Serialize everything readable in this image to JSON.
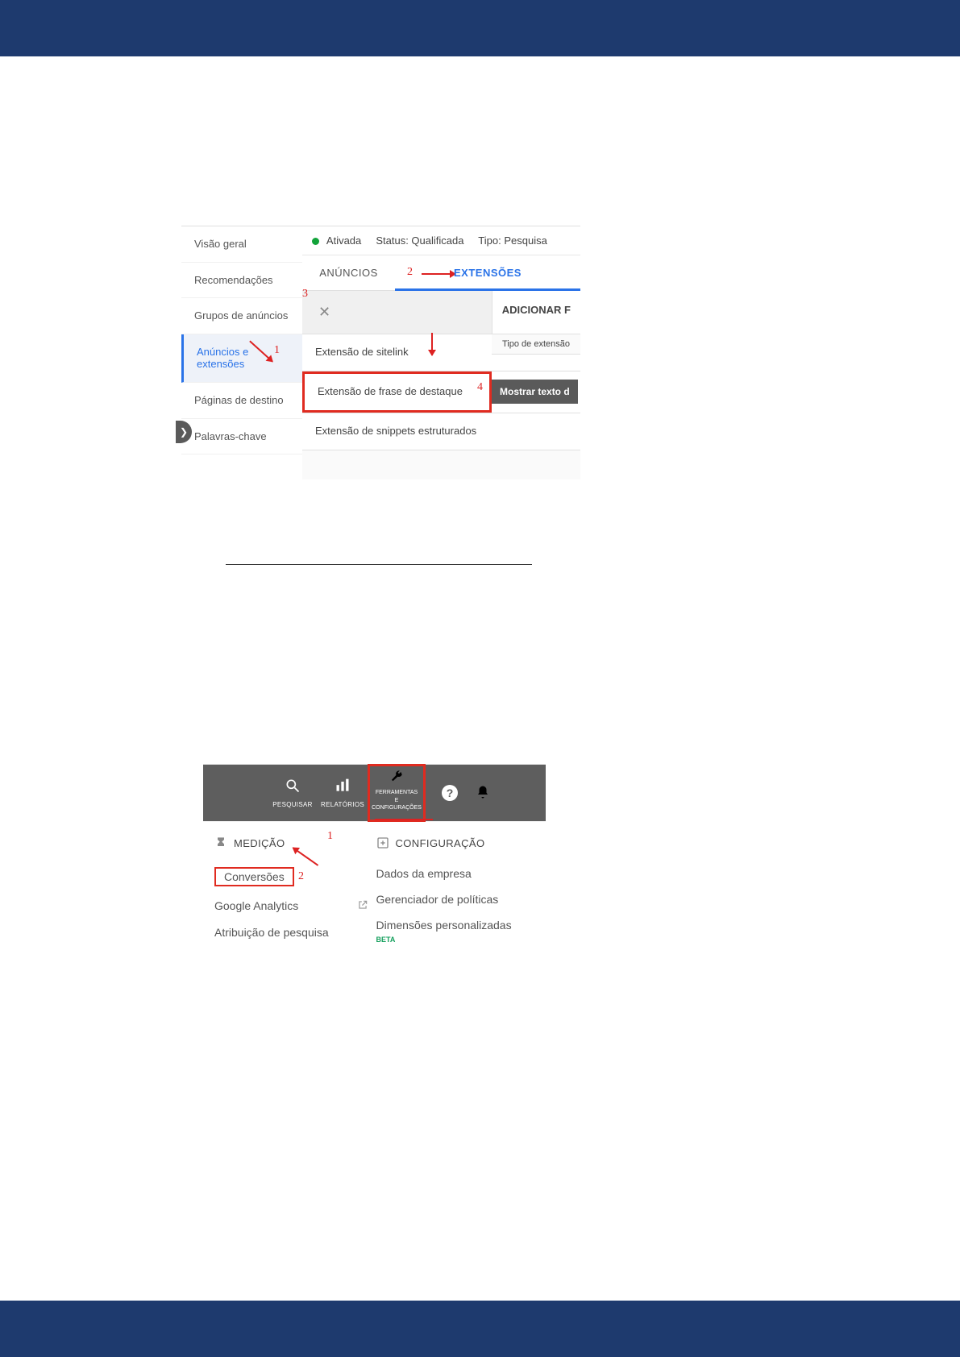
{
  "annotations": {
    "n1": "1",
    "n2": "2",
    "n3": "3",
    "n4": "4"
  },
  "shot1": {
    "sidebar": {
      "items": [
        "Visão geral",
        "Recomendações",
        "Grupos de anúncios",
        "Anúncios e extensões",
        "Páginas de destino",
        "Palavras-chave"
      ]
    },
    "status": {
      "state": "Ativada",
      "status_label": "Status: Qualificada",
      "type": "Tipo: Pesquisa"
    },
    "tabs": {
      "anuncios": "ANÚNCIOS",
      "extensoes": "EXTENSÕES"
    },
    "add_filter": "ADICIONAR F",
    "tipo_ext": "Tipo de extensão",
    "extensions": {
      "sitelink": "Extensão de sitelink",
      "frase": "Extensão de frase de destaque",
      "snippets": "Extensão de snippets estruturados",
      "mostrar": "Mostrar texto d"
    }
  },
  "shot2": {
    "top": {
      "pesquisar": "PESQUISAR",
      "relatorios": "RELATÓRIOS",
      "ferramentas_l1": "FERRAMENTAS",
      "ferramentas_l2": "E",
      "ferramentas_l3": "CONFIGURAÇÕES"
    },
    "left_col": {
      "head": "MEDIÇÃO",
      "conversoes": "Conversões",
      "ga": "Google Analytics",
      "atrib": "Atribuição de pesquisa"
    },
    "right_col": {
      "head": "CONFIGURAÇÃO",
      "dados": "Dados da empresa",
      "politicas": "Gerenciador de políticas",
      "dim": "Dimensões personalizadas",
      "beta": "BETA"
    }
  }
}
